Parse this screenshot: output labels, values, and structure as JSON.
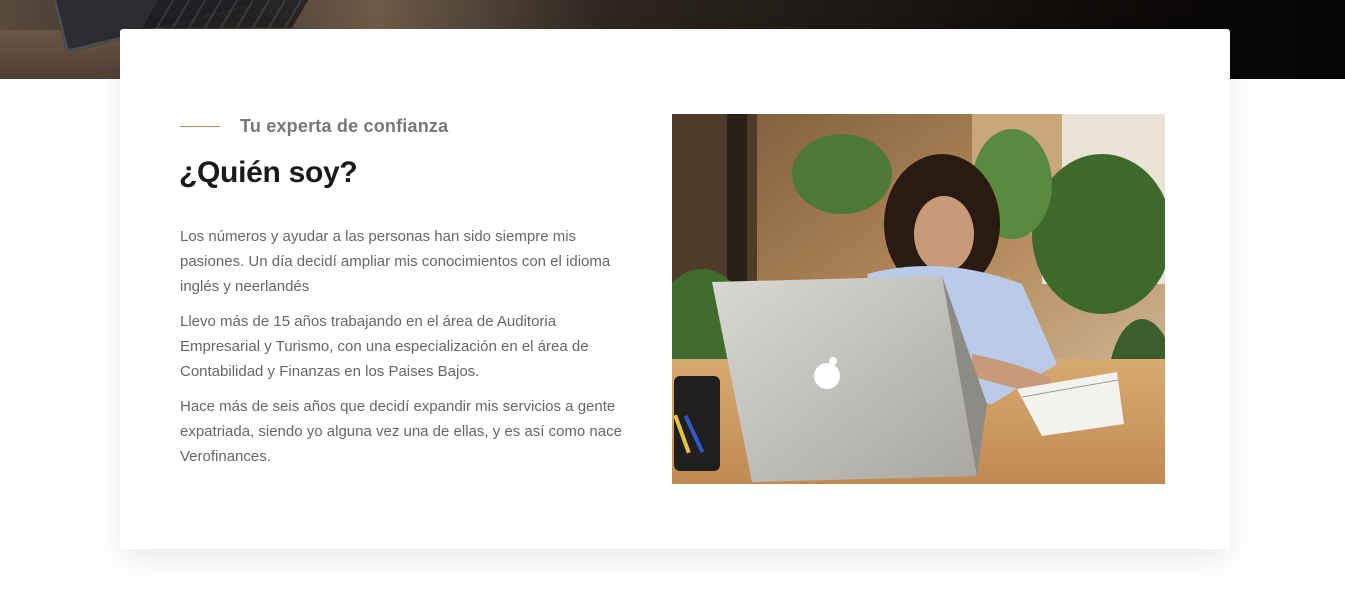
{
  "section": {
    "eyebrow": "Tu experta de confianza",
    "title": "¿Quién soy?",
    "paragraphs": [
      "Los números y ayudar a las personas han sido siempre mis pasiones. Un día decidí ampliar mis conocimientos con el idioma inglés y neerlandés",
      "Llevo más de 15 años trabajando en el área de Auditoria Empresarial y Turismo, con una especialización en el área de Contabilidad y Finanzas en los Paises Bajos.",
      "Hace más de seis años que decidí expandir mis servicios a gente expatriada, siendo yo alguna vez una de ellas, y es así como nace Verofinances."
    ]
  },
  "colors": {
    "accent": "#c38a52",
    "heading": "#1a1a1a",
    "body_text": "#666666",
    "eyebrow_text": "#777777"
  },
  "images": {
    "hero": "hero-laptop-photo",
    "portrait": "woman-working-at-laptop-photo"
  }
}
